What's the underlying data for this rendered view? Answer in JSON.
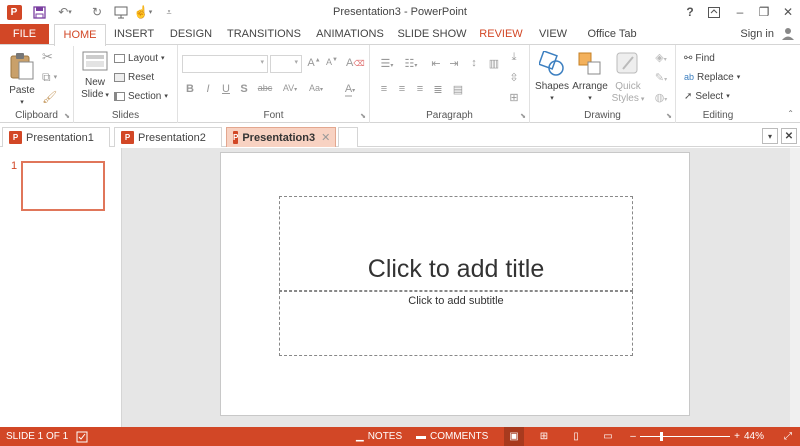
{
  "window": {
    "title": "Presentation3 - PowerPoint",
    "help": "?",
    "minimize": "–",
    "restore": "❐",
    "close": "✕"
  },
  "ribbon_tabs": [
    "FILE",
    "HOME",
    "INSERT",
    "DESIGN",
    "TRANSITIONS",
    "ANIMATIONS",
    "SLIDE SHOW",
    "REVIEW",
    "VIEW",
    "Office Tab"
  ],
  "active_tab": "HOME",
  "sign_in": "Sign in",
  "clipboard": {
    "label": "Clipboard",
    "paste": "Paste"
  },
  "slides": {
    "label": "Slides",
    "new_slide_1": "New",
    "new_slide_2": "Slide",
    "layout": "Layout",
    "reset": "Reset",
    "section": "Section"
  },
  "font": {
    "label": "Font",
    "bold": "B",
    "italic": "I",
    "underline": "U",
    "shadow": "S",
    "strike": "abc",
    "spacing": "AV",
    "case": "Aa",
    "grow": "A",
    "shrink": "A",
    "clear": "A",
    "color": "A"
  },
  "paragraph": {
    "label": "Paragraph"
  },
  "drawing": {
    "label": "Drawing",
    "shapes": "Shapes",
    "arrange": "Arrange",
    "quick_styles_1": "Quick",
    "quick_styles_2": "Styles"
  },
  "editing": {
    "label": "Editing",
    "find": "Find",
    "replace": "Replace",
    "select": "Select"
  },
  "doc_tabs": [
    {
      "name": "Presentation1",
      "active": false
    },
    {
      "name": "Presentation2",
      "active": false
    },
    {
      "name": "Presentation3",
      "active": true
    }
  ],
  "slide_number": "1",
  "slide": {
    "title_placeholder": "Click to add title",
    "subtitle_placeholder": "Click to add subtitle"
  },
  "status": {
    "slide_info": "SLIDE 1 OF 1",
    "notes": "NOTES",
    "comments": "COMMENTS",
    "zoom": "44%"
  },
  "colors": {
    "accent": "#d24726",
    "active_doc_tab": "#f8d2c2",
    "workspace": "#e6e6e6"
  }
}
